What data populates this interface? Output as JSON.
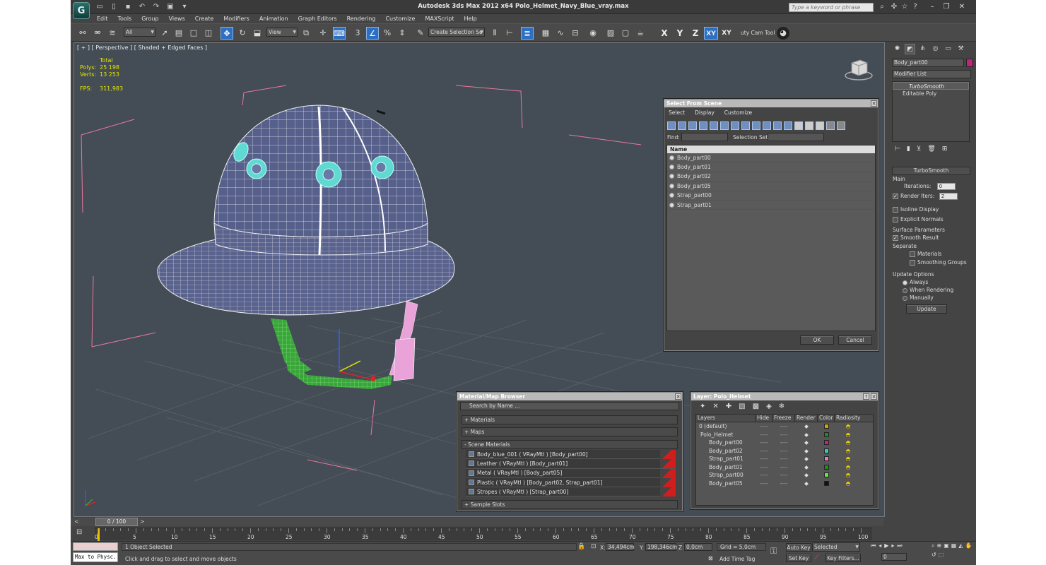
{
  "window": {
    "title": "Autodesk 3ds Max  2012 x64      Polo_Helmet_Navy_Blue_vray.max",
    "search_placeholder": "Type a keyword or phrase",
    "logo": "G"
  },
  "menu": [
    "Edit",
    "Tools",
    "Group",
    "Views",
    "Create",
    "Modifiers",
    "Animation",
    "Graph Editors",
    "Rendering",
    "Customize",
    "MAXScript",
    "Help"
  ],
  "toolbar": {
    "selection_filter": "All",
    "ref_coord": "View",
    "named_selection": "Create Selection Se",
    "axes": [
      "X",
      "Y",
      "Z",
      "XY",
      "XY"
    ],
    "cam_tool": "uty Cam Tool"
  },
  "viewport": {
    "label": "[ + ] [ Perspective ] [ Shaded + Edged Faces ]",
    "stats": {
      "total_label": "Total",
      "polys_label": "Polys:",
      "polys": "25 198",
      "verts_label": "Verts:",
      "verts": "13 253",
      "fps_label": "FPS:",
      "fps": "311,983"
    }
  },
  "select_from_scene": {
    "title": "Select From Scene",
    "menu": [
      "Select",
      "Display",
      "Customize"
    ],
    "find_label": "Find:",
    "selection_set_label": "Selection Set:",
    "column": "Name",
    "items": [
      "Body_part00",
      "Body_part01",
      "Body_part02",
      "Body_part05",
      "Strap_part00",
      "Strap_part01"
    ],
    "ok": "OK",
    "cancel": "Cancel"
  },
  "material_browser": {
    "title": "Material/Map Browser",
    "search_placeholder": "Search by Name ...",
    "sections": [
      "+ Materials",
      "+ Maps",
      "- Scene Materials"
    ],
    "scene_materials": [
      "Body_blue_001  ( VRayMtl )  [Body_part00]",
      "Leather  ( VRayMtl )  [Body_part01]",
      "Metal  ( VRayMtl )  [Body_part05]",
      "Plastic  ( VRayMtl )  [Body_part02, Strap_part01]",
      "Stropes  ( VRayMtl )  [Strap_part00]"
    ],
    "sample_slots": "+ Sample Slots"
  },
  "layer_dialog": {
    "title": "Layer: Polo_Helmet",
    "headers": [
      "Layers",
      "Hide",
      "Freeze",
      "Render",
      "Color",
      "Radiosity"
    ],
    "rows": [
      {
        "name": "0 (default)",
        "indent": 0,
        "color": "#c8a800"
      },
      {
        "name": "Polo_Helmet",
        "indent": 1,
        "color": "#1f8a1f"
      },
      {
        "name": "Body_part00",
        "indent": 2,
        "color": "#c0257a"
      },
      {
        "name": "Body_part02",
        "indent": 2,
        "color": "#35c9c4"
      },
      {
        "name": "Strap_part01",
        "indent": 2,
        "color": "#e07cc0"
      },
      {
        "name": "Body_part01",
        "indent": 2,
        "color": "#1f8a1f"
      },
      {
        "name": "Strap_part00",
        "indent": 2,
        "color": "#6de043"
      },
      {
        "name": "Body_part05",
        "indent": 2,
        "color": "#111111"
      }
    ],
    "dashes": "----"
  },
  "command_panel": {
    "object_name": "Body_part00",
    "object_color": "#c0257a",
    "modifier_list": "Modifier List",
    "stack": [
      "TurboSmooth",
      "Editable Poly"
    ],
    "turbosmooth": {
      "header": "TurboSmooth",
      "main": "Main",
      "iterations_label": "Iterations:",
      "iterations": "0",
      "render_iters_label": "Render Iters:",
      "render_iters": "2",
      "isoline": "Isoline Display",
      "explicit": "Explicit Normals",
      "surface_params": "Surface Parameters",
      "smooth_result": "Smooth Result",
      "separate": "Separate",
      "materials": "Materials",
      "smoothing_groups": "Smoothing Groups",
      "update_options": "Update Options",
      "always": "Always",
      "when_rendering": "When Rendering",
      "manually": "Manually",
      "update": "Update"
    }
  },
  "timeline": {
    "frame": "0 / 100",
    "ticks": [
      "0",
      "5",
      "10",
      "15",
      "20",
      "25",
      "30",
      "35",
      "40",
      "45",
      "50",
      "55",
      "60",
      "65",
      "70",
      "75",
      "80",
      "85",
      "90",
      "95",
      "100"
    ]
  },
  "status": {
    "script_label": "Max to Physc.",
    "selected": "1 Object Selected",
    "prompt": "Click and drag to select and move objects",
    "x_label": "X:",
    "x": "34,494cm",
    "y_label": "Y:",
    "y": "198,346cm",
    "z_label": "Z:",
    "z": "0,0cm",
    "grid": "Grid = 5,0cm",
    "add_time_tag": "Add Time Tag",
    "auto_key": "Auto Key",
    "set_key": "Set Key",
    "selected_dropdown": "Selected",
    "key_filters": "Key Filters...",
    "frame_field": "0"
  }
}
